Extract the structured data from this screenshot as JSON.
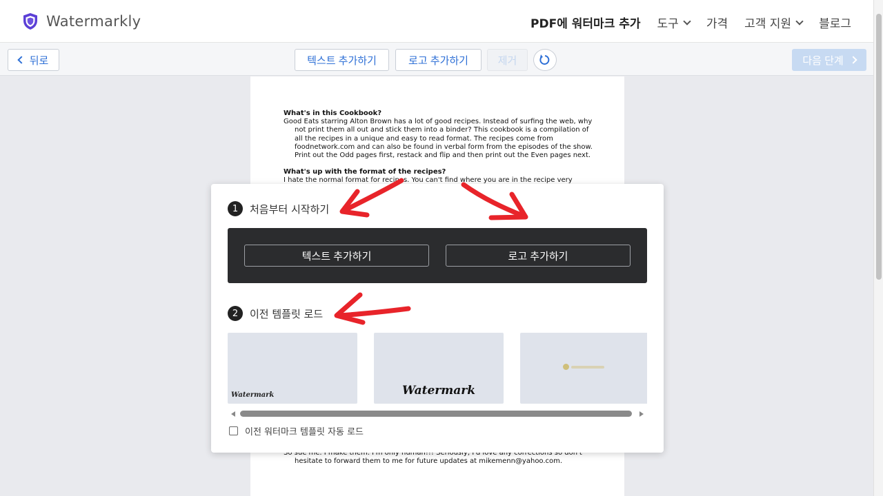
{
  "header": {
    "brand": "Watermarkly",
    "nav": [
      {
        "label": "PDF에 워터마크 추가",
        "active": true,
        "dropdown": false
      },
      {
        "label": "도구",
        "active": false,
        "dropdown": true
      },
      {
        "label": "가격",
        "active": false,
        "dropdown": false
      },
      {
        "label": "고객 지원",
        "active": false,
        "dropdown": true
      },
      {
        "label": "블로그",
        "active": false,
        "dropdown": false
      }
    ]
  },
  "toolbar": {
    "back_label": "뒤로",
    "add_text_label": "텍스트 추가하기",
    "add_logo_label": "로고 추가하기",
    "remove_label": "제거",
    "next_label": "다음 단계"
  },
  "document": {
    "heading1": "What's in this Cookbook?",
    "para1": "Good Eats starring Alton Brown has a lot of good recipes. Instead of surfing the web, why not print them all out and stick them into a binder? This cookbook is a compilation of all the recipes in a unique and easy to read format. The recipes come from foodnetwork.com and can also be found in verbal form from the episodes of the show. Print out the Odd pages first, restack and flip and then print out the Even pages next.",
    "heading2": "What's up with the format of the recipes?",
    "para2": "I hate the normal format for recipes. You can't find where you are in the recipe very easily",
    "para_bottom": "So sue me. I make them. I'm only human!!! Seriously, I'd love any corrections so don't hesitate to forward them to me for future updates at mikemenn@yahoo.com."
  },
  "modal": {
    "step1_num": "1",
    "step1_label": "처음부터 시작하기",
    "add_text_label": "텍스트 추가하기",
    "add_logo_label": "로고 추가하기",
    "step2_num": "2",
    "step2_label": "이전 템플릿 로드",
    "templates": [
      {
        "text": "Watermark"
      },
      {
        "text": "Watermark"
      },
      {
        "text": ""
      }
    ],
    "auto_load_label": "이전 워터마크 템플릿 자동 로드",
    "auto_load_checked": false
  },
  "colors": {
    "accent": "#2d6fd6",
    "brand_shield": "#5b3fd6",
    "annotation_red": "#e8242a",
    "panel_dark": "#2b2c2e"
  }
}
